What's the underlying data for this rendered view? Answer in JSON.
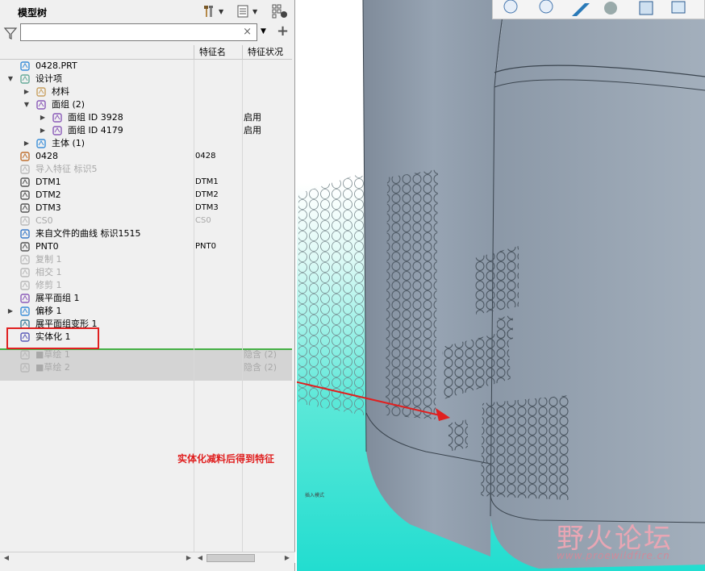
{
  "panel": {
    "title": "模型树",
    "search": {
      "value": "",
      "placeholder": ""
    }
  },
  "columns": {
    "name": "特征名",
    "status": "特征状况"
  },
  "tree": [
    {
      "label": "0428.PRT",
      "col2": "",
      "col3": "",
      "icon": "part-icon",
      "level": 0,
      "expander": "",
      "dim": false
    },
    {
      "label": "设计项",
      "col2": "",
      "col3": "",
      "icon": "design-items-icon",
      "level": 0,
      "expander": "▼",
      "dim": false
    },
    {
      "label": "材料",
      "col2": "",
      "col3": "",
      "icon": "material-icon",
      "level": 1,
      "expander": "▶",
      "dim": false
    },
    {
      "label": "面组 (2)",
      "col2": "",
      "col3": "",
      "icon": "quilt-icon",
      "level": 1,
      "expander": "▼",
      "dim": false
    },
    {
      "label": "面组 ID 3928",
      "col2": "",
      "col3": "启用",
      "icon": "quilt-icon",
      "level": 2,
      "expander": "▶",
      "dim": false
    },
    {
      "label": "面组 ID 4179",
      "col2": "",
      "col3": "启用",
      "icon": "quilt-icon",
      "level": 2,
      "expander": "▶",
      "dim": false
    },
    {
      "label": "主体 (1)",
      "col2": "",
      "col3": "",
      "icon": "body-icon",
      "level": 1,
      "expander": "▶",
      "dim": false
    },
    {
      "label": "0428",
      "col2": "0428",
      "col3": "",
      "icon": "coordinate-system-icon",
      "level": 0,
      "expander": "",
      "dim": false
    },
    {
      "label": "导入特征 标识5",
      "col2": "",
      "col3": "",
      "icon": "import-feature-icon",
      "level": 0,
      "expander": "",
      "dim": true
    },
    {
      "label": "DTM1",
      "col2": "DTM1",
      "col3": "",
      "icon": "datum-plane-icon",
      "level": 0,
      "expander": "",
      "dim": false
    },
    {
      "label": "DTM2",
      "col2": "DTM2",
      "col3": "",
      "icon": "datum-plane-icon",
      "level": 0,
      "expander": "",
      "dim": false
    },
    {
      "label": "DTM3",
      "col2": "DTM3",
      "col3": "",
      "icon": "datum-plane-icon",
      "level": 0,
      "expander": "",
      "dim": false
    },
    {
      "label": "CS0",
      "col2": "CS0",
      "col3": "",
      "icon": "coordinate-system-icon",
      "level": 0,
      "expander": "",
      "dim": true
    },
    {
      "label": "来自文件的曲线 标识1515",
      "col2": "",
      "col3": "",
      "icon": "curve-from-file-icon",
      "level": 0,
      "expander": "",
      "dim": false
    },
    {
      "label": "PNT0",
      "col2": "PNT0",
      "col3": "",
      "icon": "datum-point-icon",
      "level": 0,
      "expander": "",
      "dim": false
    },
    {
      "label": "复制 1",
      "col2": "",
      "col3": "",
      "icon": "copy-icon",
      "level": 0,
      "expander": "",
      "dim": true
    },
    {
      "label": "相交 1",
      "col2": "",
      "col3": "",
      "icon": "intersect-icon",
      "level": 0,
      "expander": "",
      "dim": true
    },
    {
      "label": "修剪 1",
      "col2": "",
      "col3": "",
      "icon": "trim-icon",
      "level": 0,
      "expander": "",
      "dim": true
    },
    {
      "label": "展平面组 1",
      "col2": "",
      "col3": "",
      "icon": "flatten-quilt-icon",
      "level": 0,
      "expander": "",
      "dim": false
    },
    {
      "label": "偏移 1",
      "col2": "",
      "col3": "",
      "icon": "offset-icon",
      "level": 0,
      "expander": "▶",
      "dim": false
    },
    {
      "label": "展平面组变形 1",
      "col2": "",
      "col3": "",
      "icon": "flatten-deform-icon",
      "level": 0,
      "expander": "",
      "dim": false
    },
    {
      "label": "实体化 1",
      "col2": "",
      "col3": "",
      "icon": "solidify-icon",
      "level": 0,
      "expander": "",
      "dim": false
    },
    {
      "label": "■草绘 1",
      "col2": "",
      "col3": "隐含 (2)",
      "icon": "sketch-icon",
      "level": 0,
      "expander": "",
      "dim": true
    },
    {
      "label": "■草绘 2",
      "col2": "",
      "col3": "隐含 (2)",
      "icon": "sketch-icon",
      "level": 0,
      "expander": "",
      "dim": true
    }
  ],
  "annotation": "实体化减料后得到特征",
  "small_note": "插入模式",
  "watermark": {
    "cn": "野火论坛",
    "en": "www.proewildfire.cn"
  },
  "colors": {
    "accent_red": "#e02020",
    "insert_line": "#44b044",
    "model_gray": "#8e9cab",
    "background_teal": "#37e0d0"
  }
}
